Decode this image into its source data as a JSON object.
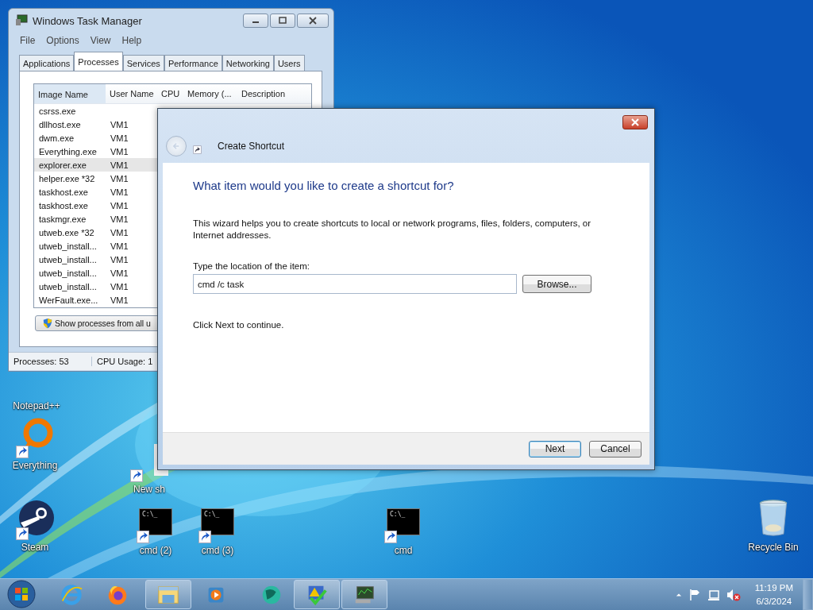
{
  "desktop_icons": [
    {
      "label": "Notepad++",
      "kind": "covered",
      "shortcut": false
    },
    {
      "label": "Everything",
      "kind": "ring",
      "shortcut": true
    },
    {
      "label": "New sh",
      "kind": "blank",
      "shortcut": true
    },
    {
      "label": "Steam",
      "kind": "steam",
      "shortcut": true
    },
    {
      "label": "cmd (2)",
      "kind": "console",
      "shortcut": true,
      "glyph": "C:\\_"
    },
    {
      "label": "cmd (3)",
      "kind": "console",
      "shortcut": true,
      "glyph": "C:\\_"
    },
    {
      "label": "cmd",
      "kind": "console",
      "shortcut": true,
      "glyph": "C:\\_"
    },
    {
      "label": "Recycle Bin",
      "kind": "bin",
      "shortcut": false
    }
  ],
  "task_manager": {
    "title": "Windows Task Manager",
    "menu": [
      "File",
      "Options",
      "View",
      "Help"
    ],
    "tabs": [
      {
        "label": "Applications",
        "selected": false
      },
      {
        "label": "Processes",
        "selected": true
      },
      {
        "label": "Services",
        "selected": false
      },
      {
        "label": "Performance",
        "selected": false
      },
      {
        "label": "Networking",
        "selected": false
      },
      {
        "label": "Users",
        "selected": false
      }
    ],
    "columns": [
      "Image Name",
      "User Name",
      "CPU",
      "Memory (...",
      "Description"
    ],
    "rows": [
      {
        "name": "csrss.exe",
        "user": "",
        "selected": false
      },
      {
        "name": "dllhost.exe",
        "user": "VM1",
        "selected": false
      },
      {
        "name": "dwm.exe",
        "user": "VM1",
        "selected": false
      },
      {
        "name": "Everything.exe",
        "user": "VM1",
        "selected": false
      },
      {
        "name": "explorer.exe",
        "user": "VM1",
        "selected": true
      },
      {
        "name": "helper.exe *32",
        "user": "VM1",
        "selected": false
      },
      {
        "name": "taskhost.exe",
        "user": "VM1",
        "selected": false
      },
      {
        "name": "taskhost.exe",
        "user": "VM1",
        "selected": false
      },
      {
        "name": "taskmgr.exe",
        "user": "VM1",
        "selected": false
      },
      {
        "name": "utweb.exe *32",
        "user": "VM1",
        "selected": false
      },
      {
        "name": "utweb_install...",
        "user": "VM1",
        "selected": false
      },
      {
        "name": "utweb_install...",
        "user": "VM1",
        "selected": false
      },
      {
        "name": "utweb_install...",
        "user": "VM1",
        "selected": false
      },
      {
        "name": "utweb_install...",
        "user": "VM1",
        "selected": false
      },
      {
        "name": "WerFault.exe...",
        "user": "VM1",
        "selected": false
      }
    ],
    "show_all_button": "Show processes from all u",
    "status": [
      "Processes: 53",
      "CPU Usage: 1"
    ]
  },
  "dialog": {
    "title": "Create Shortcut",
    "heading": "What item would you like to create a shortcut for?",
    "intro": "This wizard helps you to create shortcuts to local or network programs, files, folders, computers, or Internet addresses.",
    "field_label": "Type the location of the item:",
    "field_value": "cmd /c task",
    "browse": "Browse...",
    "hint": "Click Next to continue.",
    "buttons": [
      {
        "label": "Next",
        "default": true
      },
      {
        "label": "Cancel",
        "default": false
      }
    ]
  },
  "taskbar": {
    "buttons": [
      {
        "kind": "browser-e",
        "running": false
      },
      {
        "kind": "fox",
        "running": false
      },
      {
        "kind": "folder",
        "running": true
      },
      {
        "kind": "player",
        "running": false
      },
      {
        "kind": "globe",
        "running": false
      },
      {
        "kind": "check",
        "running": true
      },
      {
        "kind": "monitor",
        "running": true
      }
    ],
    "clock_time": "11:19 PM",
    "clock_date": "6/3/2024"
  }
}
